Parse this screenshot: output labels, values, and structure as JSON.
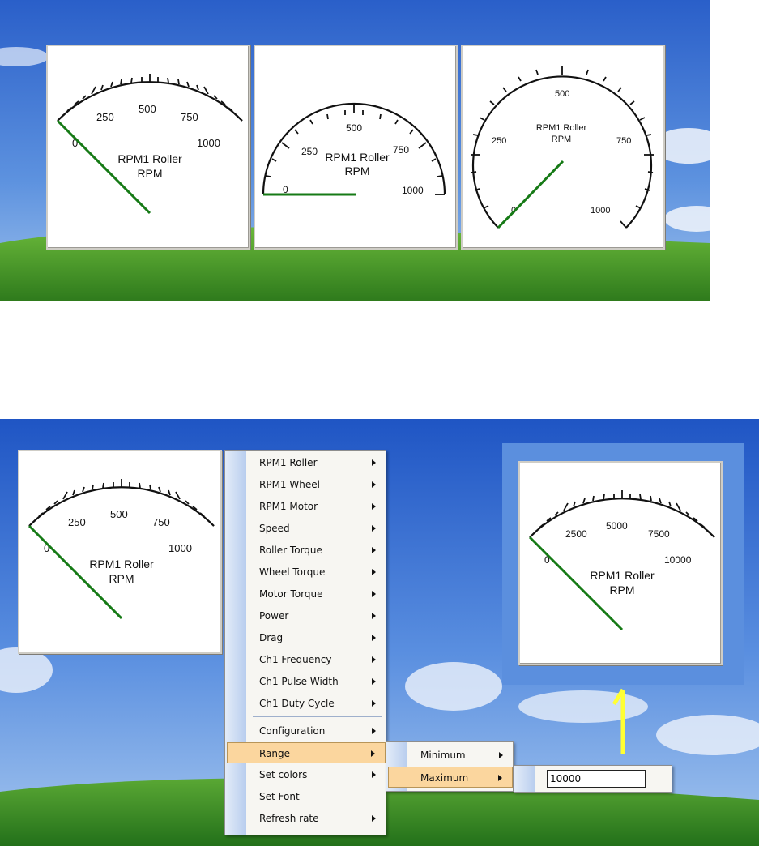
{
  "top_gauges": [
    {
      "label_line1": "RPM1 Roller",
      "label_line2": "RPM",
      "ticks": [
        "0",
        "250",
        "500",
        "750",
        "1000"
      ]
    },
    {
      "label_line1": "RPM1 Roller",
      "label_line2": "RPM",
      "ticks": [
        "0",
        "250",
        "500",
        "750",
        "1000"
      ]
    },
    {
      "label_line1": "RPM1 Roller",
      "label_line2": "RPM",
      "ticks": [
        "0",
        "250",
        "500",
        "750",
        "1000"
      ]
    }
  ],
  "bottom_left_gauge": {
    "label_line1": "RPM1 Roller",
    "label_line2": "RPM",
    "ticks": [
      "0",
      "250",
      "500",
      "750",
      "1000"
    ]
  },
  "bottom_right_gauge": {
    "label_line1": "RPM1 Roller",
    "label_line2": "RPM",
    "ticks": [
      "0",
      "2500",
      "5000",
      "7500",
      "10000"
    ]
  },
  "context_menu": {
    "items": [
      {
        "label": "RPM1 Roller"
      },
      {
        "label": "RPM1 Wheel"
      },
      {
        "label": "RPM1 Motor"
      },
      {
        "label": "Speed"
      },
      {
        "label": "Roller Torque"
      },
      {
        "label": "Wheel Torque"
      },
      {
        "label": "Motor Torque"
      },
      {
        "label": "Power"
      },
      {
        "label": "Drag"
      },
      {
        "label": "Ch1 Frequency"
      },
      {
        "label": "Ch1 Pulse Width"
      },
      {
        "label": "Ch1 Duty Cycle"
      },
      {
        "label": "Configuration"
      },
      {
        "label": "Range"
      },
      {
        "label": "Set colors"
      },
      {
        "label": "Set Font"
      },
      {
        "label": "Refresh rate"
      }
    ]
  },
  "range_submenu": {
    "items": [
      {
        "label": "Minimum"
      },
      {
        "label": "Maximum"
      }
    ]
  },
  "maximum_input": {
    "value": "10000"
  },
  "colors": {
    "needle": "#167a16",
    "highlight": "#fbd69e",
    "arrow": "#ffff33"
  }
}
